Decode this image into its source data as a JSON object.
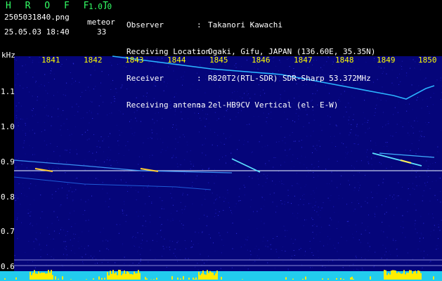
{
  "app": {
    "name": "H R O F F T",
    "version": "1.0.0"
  },
  "file": {
    "name": "2505031840.png",
    "date": "25.05.03 18:40"
  },
  "meteor": {
    "label": "meteor",
    "count": "33"
  },
  "info": [
    {
      "key": "Observer",
      "value": "Takanori Kawachi"
    },
    {
      "key": "Receiving Location",
      "value": "Ogaki, Gifu, JAPAN (136.60E, 35.35N)"
    },
    {
      "key": "Receiver",
      "value": "R820T2(RTL-SDR) SDR-Sharp 53.372MHz"
    },
    {
      "key": "Receiving antenna",
      "value": "2el-HB9CV Vertical (el. E-W)"
    }
  ],
  "axis": {
    "y_unit": "kHz",
    "y_ticks": [
      "1.1",
      "1.0",
      "0.9",
      "0.8",
      "0.7",
      "0.6"
    ],
    "x_ticks": [
      "1841",
      "1842",
      "1843",
      "1844",
      "1845",
      "1846",
      "1847",
      "1848",
      "1849",
      "1850"
    ]
  },
  "colors": {
    "title_green": "#33ff66",
    "tick_yellow": "#ffff00",
    "noise_blue": "#0a0a8c"
  }
}
